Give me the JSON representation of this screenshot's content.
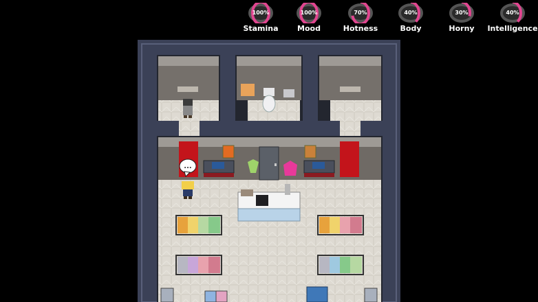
{
  "hud": {
    "accent_color": "#e0458f",
    "stats": [
      {
        "label": "Stamina",
        "value": "100%",
        "fraction": 1.0
      },
      {
        "label": "Mood",
        "value": "100%",
        "fraction": 1.0
      },
      {
        "label": "Hotness",
        "value": "70%",
        "fraction": 0.7
      },
      {
        "label": "Body",
        "value": "40%",
        "fraction": 0.4
      },
      {
        "label": "Horny",
        "value": "30%",
        "fraction": 0.3
      },
      {
        "label": "Intelligence",
        "value": "40%",
        "fraction": 0.4
      }
    ]
  },
  "scene": {
    "speech_bubble": "...",
    "floor_color": "#dcd8cf",
    "wall_color": "#3c4258"
  }
}
